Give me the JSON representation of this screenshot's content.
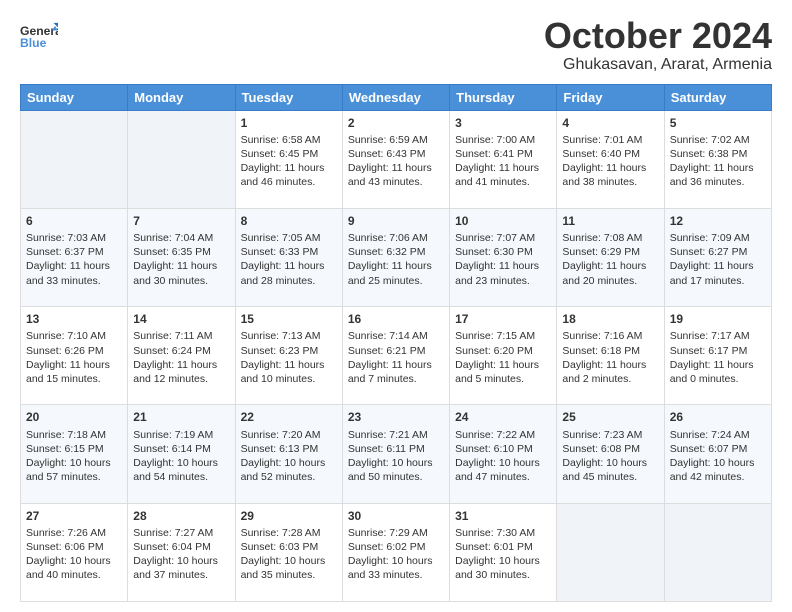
{
  "header": {
    "logo_general": "General",
    "logo_blue": "Blue",
    "month": "October 2024",
    "location": "Ghukasavan, Ararat, Armenia"
  },
  "weekdays": [
    "Sunday",
    "Monday",
    "Tuesday",
    "Wednesday",
    "Thursday",
    "Friday",
    "Saturday"
  ],
  "weeks": [
    [
      {
        "day": "",
        "sunrise": "",
        "sunset": "",
        "daylight": ""
      },
      {
        "day": "",
        "sunrise": "",
        "sunset": "",
        "daylight": ""
      },
      {
        "day": "1",
        "sunrise": "Sunrise: 6:58 AM",
        "sunset": "Sunset: 6:45 PM",
        "daylight": "Daylight: 11 hours and 46 minutes."
      },
      {
        "day": "2",
        "sunrise": "Sunrise: 6:59 AM",
        "sunset": "Sunset: 6:43 PM",
        "daylight": "Daylight: 11 hours and 43 minutes."
      },
      {
        "day": "3",
        "sunrise": "Sunrise: 7:00 AM",
        "sunset": "Sunset: 6:41 PM",
        "daylight": "Daylight: 11 hours and 41 minutes."
      },
      {
        "day": "4",
        "sunrise": "Sunrise: 7:01 AM",
        "sunset": "Sunset: 6:40 PM",
        "daylight": "Daylight: 11 hours and 38 minutes."
      },
      {
        "day": "5",
        "sunrise": "Sunrise: 7:02 AM",
        "sunset": "Sunset: 6:38 PM",
        "daylight": "Daylight: 11 hours and 36 minutes."
      }
    ],
    [
      {
        "day": "6",
        "sunrise": "Sunrise: 7:03 AM",
        "sunset": "Sunset: 6:37 PM",
        "daylight": "Daylight: 11 hours and 33 minutes."
      },
      {
        "day": "7",
        "sunrise": "Sunrise: 7:04 AM",
        "sunset": "Sunset: 6:35 PM",
        "daylight": "Daylight: 11 hours and 30 minutes."
      },
      {
        "day": "8",
        "sunrise": "Sunrise: 7:05 AM",
        "sunset": "Sunset: 6:33 PM",
        "daylight": "Daylight: 11 hours and 28 minutes."
      },
      {
        "day": "9",
        "sunrise": "Sunrise: 7:06 AM",
        "sunset": "Sunset: 6:32 PM",
        "daylight": "Daylight: 11 hours and 25 minutes."
      },
      {
        "day": "10",
        "sunrise": "Sunrise: 7:07 AM",
        "sunset": "Sunset: 6:30 PM",
        "daylight": "Daylight: 11 hours and 23 minutes."
      },
      {
        "day": "11",
        "sunrise": "Sunrise: 7:08 AM",
        "sunset": "Sunset: 6:29 PM",
        "daylight": "Daylight: 11 hours and 20 minutes."
      },
      {
        "day": "12",
        "sunrise": "Sunrise: 7:09 AM",
        "sunset": "Sunset: 6:27 PM",
        "daylight": "Daylight: 11 hours and 17 minutes."
      }
    ],
    [
      {
        "day": "13",
        "sunrise": "Sunrise: 7:10 AM",
        "sunset": "Sunset: 6:26 PM",
        "daylight": "Daylight: 11 hours and 15 minutes."
      },
      {
        "day": "14",
        "sunrise": "Sunrise: 7:11 AM",
        "sunset": "Sunset: 6:24 PM",
        "daylight": "Daylight: 11 hours and 12 minutes."
      },
      {
        "day": "15",
        "sunrise": "Sunrise: 7:13 AM",
        "sunset": "Sunset: 6:23 PM",
        "daylight": "Daylight: 11 hours and 10 minutes."
      },
      {
        "day": "16",
        "sunrise": "Sunrise: 7:14 AM",
        "sunset": "Sunset: 6:21 PM",
        "daylight": "Daylight: 11 hours and 7 minutes."
      },
      {
        "day": "17",
        "sunrise": "Sunrise: 7:15 AM",
        "sunset": "Sunset: 6:20 PM",
        "daylight": "Daylight: 11 hours and 5 minutes."
      },
      {
        "day": "18",
        "sunrise": "Sunrise: 7:16 AM",
        "sunset": "Sunset: 6:18 PM",
        "daylight": "Daylight: 11 hours and 2 minutes."
      },
      {
        "day": "19",
        "sunrise": "Sunrise: 7:17 AM",
        "sunset": "Sunset: 6:17 PM",
        "daylight": "Daylight: 11 hours and 0 minutes."
      }
    ],
    [
      {
        "day": "20",
        "sunrise": "Sunrise: 7:18 AM",
        "sunset": "Sunset: 6:15 PM",
        "daylight": "Daylight: 10 hours and 57 minutes."
      },
      {
        "day": "21",
        "sunrise": "Sunrise: 7:19 AM",
        "sunset": "Sunset: 6:14 PM",
        "daylight": "Daylight: 10 hours and 54 minutes."
      },
      {
        "day": "22",
        "sunrise": "Sunrise: 7:20 AM",
        "sunset": "Sunset: 6:13 PM",
        "daylight": "Daylight: 10 hours and 52 minutes."
      },
      {
        "day": "23",
        "sunrise": "Sunrise: 7:21 AM",
        "sunset": "Sunset: 6:11 PM",
        "daylight": "Daylight: 10 hours and 50 minutes."
      },
      {
        "day": "24",
        "sunrise": "Sunrise: 7:22 AM",
        "sunset": "Sunset: 6:10 PM",
        "daylight": "Daylight: 10 hours and 47 minutes."
      },
      {
        "day": "25",
        "sunrise": "Sunrise: 7:23 AM",
        "sunset": "Sunset: 6:08 PM",
        "daylight": "Daylight: 10 hours and 45 minutes."
      },
      {
        "day": "26",
        "sunrise": "Sunrise: 7:24 AM",
        "sunset": "Sunset: 6:07 PM",
        "daylight": "Daylight: 10 hours and 42 minutes."
      }
    ],
    [
      {
        "day": "27",
        "sunrise": "Sunrise: 7:26 AM",
        "sunset": "Sunset: 6:06 PM",
        "daylight": "Daylight: 10 hours and 40 minutes."
      },
      {
        "day": "28",
        "sunrise": "Sunrise: 7:27 AM",
        "sunset": "Sunset: 6:04 PM",
        "daylight": "Daylight: 10 hours and 37 minutes."
      },
      {
        "day": "29",
        "sunrise": "Sunrise: 7:28 AM",
        "sunset": "Sunset: 6:03 PM",
        "daylight": "Daylight: 10 hours and 35 minutes."
      },
      {
        "day": "30",
        "sunrise": "Sunrise: 7:29 AM",
        "sunset": "Sunset: 6:02 PM",
        "daylight": "Daylight: 10 hours and 33 minutes."
      },
      {
        "day": "31",
        "sunrise": "Sunrise: 7:30 AM",
        "sunset": "Sunset: 6:01 PM",
        "daylight": "Daylight: 10 hours and 30 minutes."
      },
      {
        "day": "",
        "sunrise": "",
        "sunset": "",
        "daylight": ""
      },
      {
        "day": "",
        "sunrise": "",
        "sunset": "",
        "daylight": ""
      }
    ]
  ]
}
